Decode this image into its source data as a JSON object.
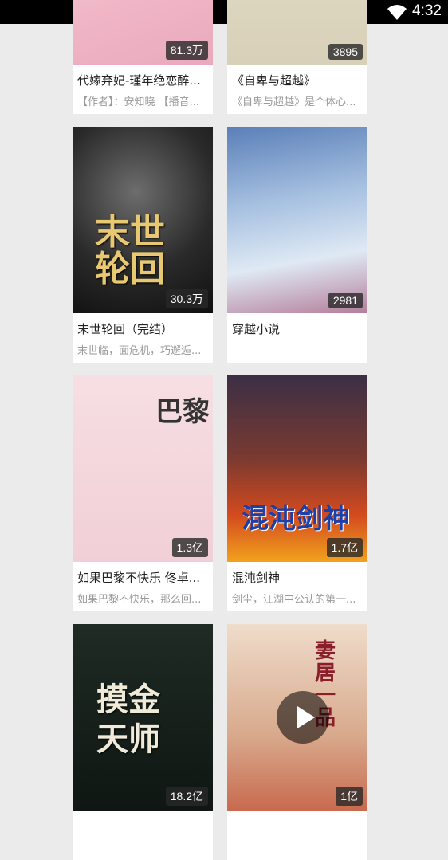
{
  "status_bar": {
    "time": "4:32",
    "wifi_icon": "wifi-icon"
  },
  "books": [
    {
      "title": "代嫁弃妃-瑾年绝恋醉...",
      "desc": "【作者】：安知晓 【播音...",
      "count": "81.3万"
    },
    {
      "title": "《自卑与超越》",
      "desc": "《自卑与超越》是个体心...",
      "count": "3895"
    },
    {
      "title": "末世轮回（完结）",
      "desc": "末世临，面危机，巧邂逅...",
      "count": "30.3万",
      "cover_text": "末世轮回"
    },
    {
      "title": "穿越小说",
      "desc": "",
      "count": "2981"
    },
    {
      "title": "如果巴黎不快乐 佟卓...",
      "desc": "如果巴黎不快乐，那么回...",
      "count": "1.3亿",
      "cover_text": "巴黎"
    },
    {
      "title": "混沌剑神",
      "desc": "剑尘，江湖中公认的第一...",
      "count": "1.7亿",
      "cover_text": "混沌剑神"
    },
    {
      "title": "",
      "desc": "",
      "count": "18.2亿",
      "cover_text": "摸金天师"
    },
    {
      "title": "",
      "desc": "",
      "count": "1亿",
      "cover_text": "妻居一品"
    }
  ]
}
